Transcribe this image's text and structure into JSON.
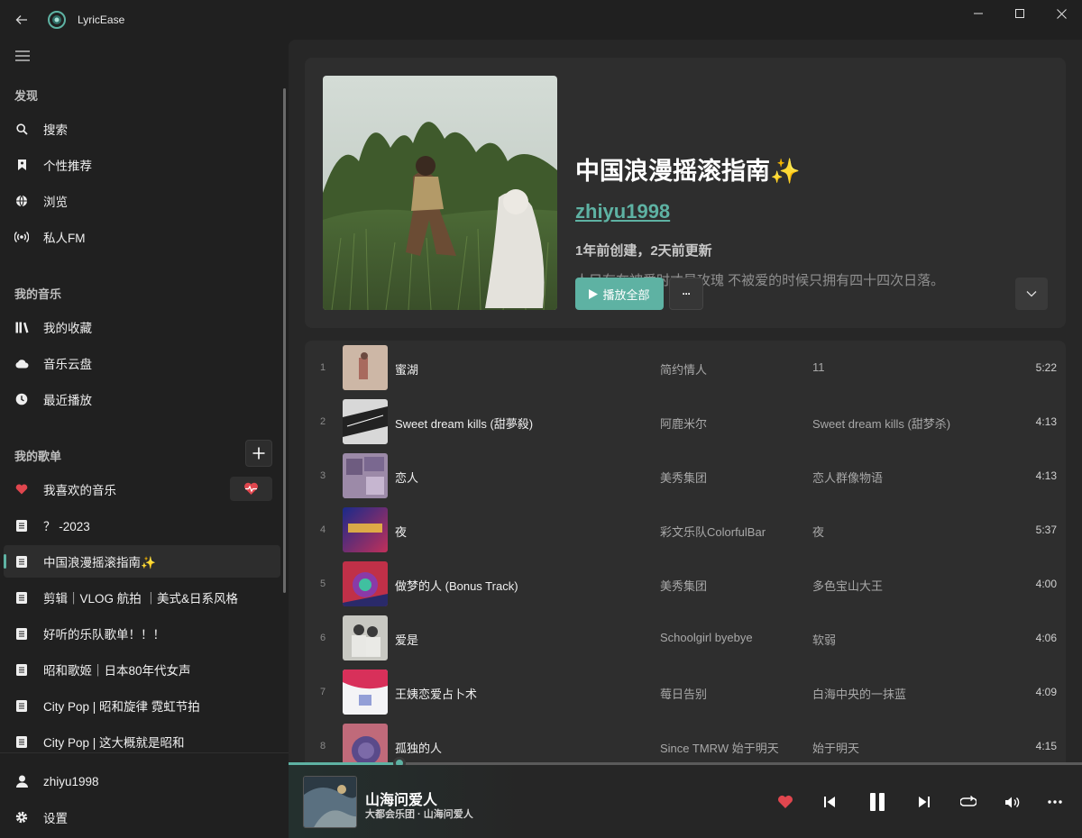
{
  "app": {
    "title": "LyricEase"
  },
  "sidebar": {
    "discover_header": "发现",
    "discover": [
      {
        "label": "搜索",
        "icon": "search-icon"
      },
      {
        "label": "个性推荐",
        "icon": "bookmark-icon"
      },
      {
        "label": "浏览",
        "icon": "globe-icon"
      },
      {
        "label": "私人FM",
        "icon": "radio-icon"
      }
    ],
    "mymusic_header": "我的音乐",
    "mymusic": [
      {
        "label": "我的收藏",
        "icon": "library-icon"
      },
      {
        "label": "音乐云盘",
        "icon": "cloud-icon"
      },
      {
        "label": "最近播放",
        "icon": "clock-icon"
      }
    ],
    "playlists_header": "我的歌单",
    "playlists": [
      {
        "label": "我喜欢的音乐",
        "icon": "heart-icon"
      },
      {
        "label": "？ -2023",
        "icon": "list-icon"
      },
      {
        "label": "中国浪漫摇滚指南✨",
        "icon": "list-icon"
      },
      {
        "label": "剪辑｜VLOG 航拍 ｜美式&日系风格",
        "icon": "list-icon"
      },
      {
        "label": "好听的乐队歌单！！！",
        "icon": "list-icon"
      },
      {
        "label": "昭和歌姬｜日本80年代女声",
        "icon": "list-icon"
      },
      {
        "label": "City Pop | 昭和旋律 霓虹节拍",
        "icon": "list-icon"
      },
      {
        "label": "City Pop | 这大概就是昭和",
        "icon": "list-icon"
      }
    ],
    "account": {
      "label": "zhiyu1998",
      "icon": "person-icon"
    },
    "settings": {
      "label": "设置",
      "icon": "gear-icon"
    }
  },
  "playlist": {
    "title": "中国浪漫摇滚指南✨",
    "creator": "zhiyu1998",
    "meta": "1年前创建，2天前更新",
    "description": "人只有在被爱时才是玫瑰 不被爱的时候只拥有四十四次日落。",
    "play_all_label": "播放全部",
    "more_label": "···"
  },
  "tracks": [
    {
      "num": "1",
      "title": "蜜湖",
      "artist": "简约情人",
      "album": "11",
      "duration": "5:22"
    },
    {
      "num": "2",
      "title": "Sweet dream kills (甜夢殺)",
      "artist": "阿鹿米尔",
      "album": "Sweet dream kills (甜梦杀)",
      "duration": "4:13"
    },
    {
      "num": "3",
      "title": "恋人",
      "artist": "美秀集团",
      "album": "恋人群像物语",
      "duration": "4:13"
    },
    {
      "num": "4",
      "title": "夜",
      "artist": "彩文乐队ColorfulBar",
      "album": "夜",
      "duration": "5:37"
    },
    {
      "num": "5",
      "title": "做梦的人 (Bonus Track)",
      "artist": "美秀集团",
      "album": "多色宝山大王",
      "duration": "4:00"
    },
    {
      "num": "6",
      "title": "爱是",
      "artist": "Schoolgirl byebye",
      "album": "软弱",
      "duration": "4:06"
    },
    {
      "num": "7",
      "title": "王姨恋爱占卜术",
      "artist": "莓日告别",
      "album": "白海中央的一抹蓝",
      "duration": "4:09"
    },
    {
      "num": "8",
      "title": "孤独的人",
      "artist": "Since TMRW 始于明天",
      "album": "始于明天",
      "duration": "4:15"
    }
  ],
  "player": {
    "title": "山海问爱人",
    "subtitle": "大都会乐团 · 山海问爱人",
    "progress_fraction": 0.14,
    "accent": "#5eb2a3",
    "liked_color": "#e0464e"
  }
}
